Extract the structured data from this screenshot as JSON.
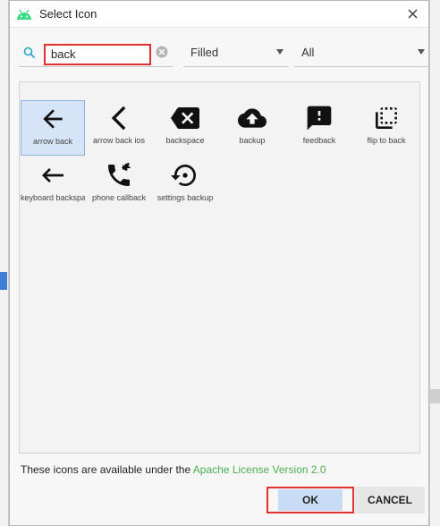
{
  "dialog": {
    "title": "Select Icon",
    "search": {
      "value": "back"
    },
    "style_select": {
      "selected": "Filled"
    },
    "category_select": {
      "selected": "All"
    },
    "icons": [
      {
        "label": "arrow back",
        "icon": "arrow-back-icon",
        "selected": true
      },
      {
        "label": "arrow back ios",
        "icon": "arrow-back-ios-icon"
      },
      {
        "label": "backspace",
        "icon": "backspace-icon"
      },
      {
        "label": "backup",
        "icon": "backup-icon"
      },
      {
        "label": "feedback",
        "icon": "feedback-icon"
      },
      {
        "label": "flip to back",
        "icon": "flip-to-back-icon"
      },
      {
        "label": "keyboard backspace",
        "icon": "keyboard-backspace-icon"
      },
      {
        "label": "phone callback",
        "icon": "phone-callback-icon"
      },
      {
        "label": "settings backup",
        "icon": "settings-backup-restore-icon"
      }
    ],
    "license": {
      "text": "These icons are available under the ",
      "link": "Apache License Version 2.0"
    },
    "ok_label": "OK",
    "cancel_label": "CANCEL"
  },
  "colors": {
    "selection": "#d6e4f7",
    "highlight_border": "#e0312f",
    "link": "#4caf50",
    "search_accent": "#2aa4c9",
    "android_green": "#3ddc84"
  }
}
